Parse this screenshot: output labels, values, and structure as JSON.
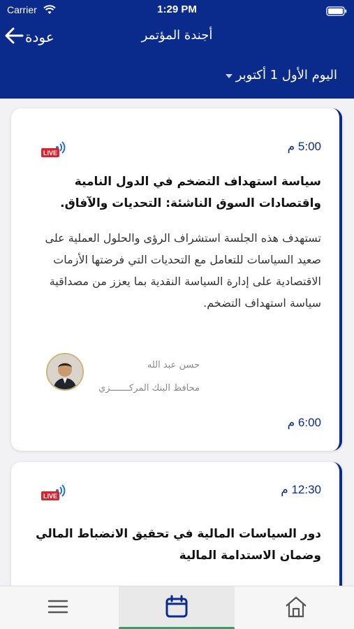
{
  "status_bar": {
    "carrier": "Carrier",
    "time": "1:29 PM"
  },
  "nav": {
    "back_label": "عودة",
    "title": "أجندة المؤتمر"
  },
  "day_selector": {
    "label": "اليوم الأول 1 أكتوبر"
  },
  "sessions": [
    {
      "start_time": "5:00 م",
      "live_label": "LIVE",
      "title": "سياسة استهداف التضخم في الدول النامية واقتصادات السوق الناشئة: التحديات والآفاق.",
      "description": "تستهدف هذه الجلسة استشراف الرؤى والحلول العملية على صعيد السياسات للتعامل مع التحديات التي فرضتها الأزمات الاقتصادية على إدارة السياسة النقدية بما يعزز من مصداقية سياسة استهداف التضخم.",
      "speaker_name": "حسن عبد الله",
      "speaker_role": "محافظ البنك المركـــــــزي",
      "end_time": "6:00 م"
    },
    {
      "start_time": "12:30 م",
      "live_label": "LIVE",
      "title": "دور السياسات المالية في تحقيق الانضباط المالي وضمان الاستدامة المالية"
    }
  ],
  "tabbar": {
    "items": [
      "menu-icon",
      "calendar-icon",
      "home-icon"
    ],
    "active": "calendar-icon"
  },
  "colors": {
    "primary": "#0a2a8c",
    "live_red": "#d9232e",
    "live_blue": "#1f6fd1",
    "tab_indicator": "#2aa56a"
  }
}
